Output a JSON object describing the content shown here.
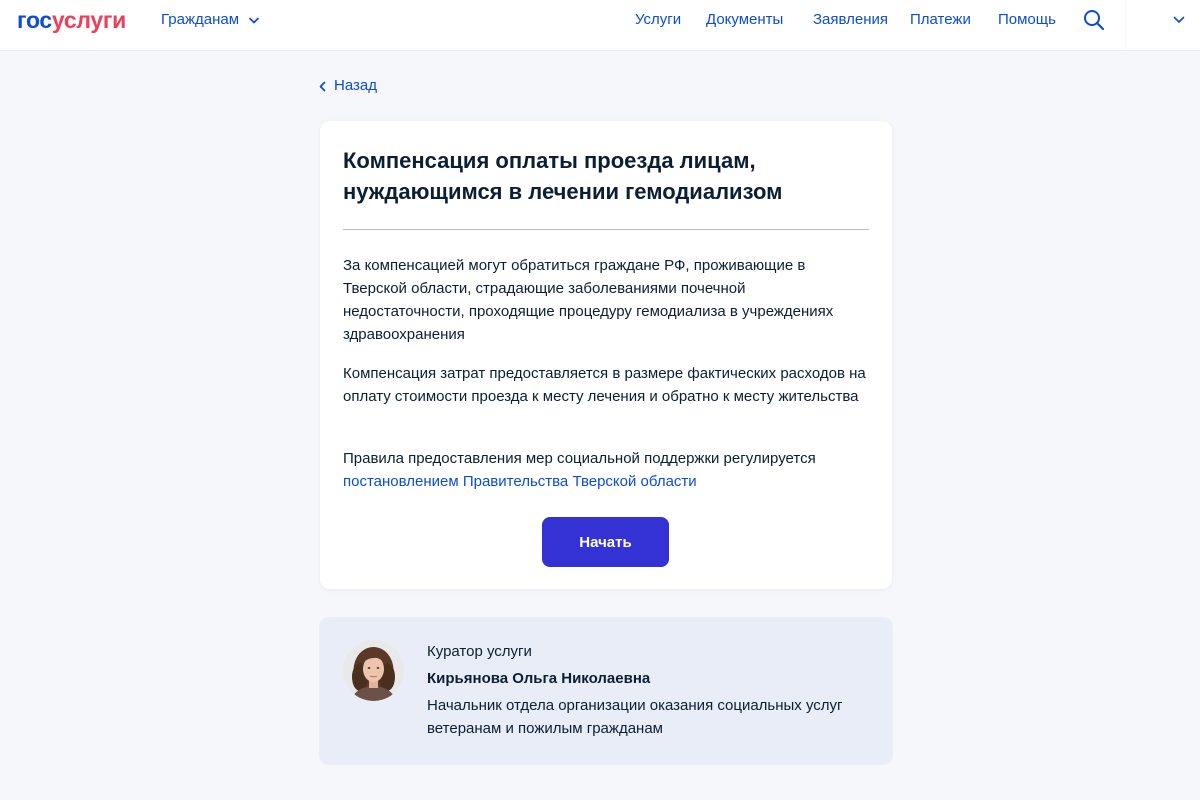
{
  "header": {
    "logo_part1": "гос",
    "logo_part2": "услуги",
    "role_label": "Гражданам",
    "nav": [
      "Услуги",
      "Документы",
      "Заявления",
      "Платежи",
      "Помощь"
    ]
  },
  "back_label": "Назад",
  "service": {
    "title": "Компенсация оплаты проезда лицам, нуждающимся в лечении гемодиализом",
    "paragraph1": "За компенсацией могут обратиться граждане РФ, проживающие в Тверской области, страдающие заболеваниями почечной недостаточности, проходящие процедуру гемодиализа в учреждениях здравоохранения",
    "paragraph2": "Компенсация затрат предоставляется в размере фактических расходов на оплату стоимости проезда к месту лечения и обратно к месту жительства",
    "paragraph3_text": "Правила предоставления мер социальной поддержки регулируется",
    "paragraph3_link": "постановлением Правительства Тверской области",
    "start_label": "Начать"
  },
  "curator": {
    "caption": "Куратор услуги",
    "name": "Кирьянова Ольга Николаевна",
    "position": "Начальник отдела организации оказания социальных услуг ветеранам и пожилым гражданам"
  },
  "colors": {
    "accent": "#0d4cd3",
    "brand_red": "#ee3f58",
    "button": "#3431d5",
    "page_bg": "#f5f7fa",
    "curator_bg": "#e8edf7"
  },
  "icons": {
    "role_dropdown": "chevron-down-icon",
    "search": "search-icon",
    "back": "chevron-left-icon",
    "header_menu": "chevron-down-icon"
  }
}
